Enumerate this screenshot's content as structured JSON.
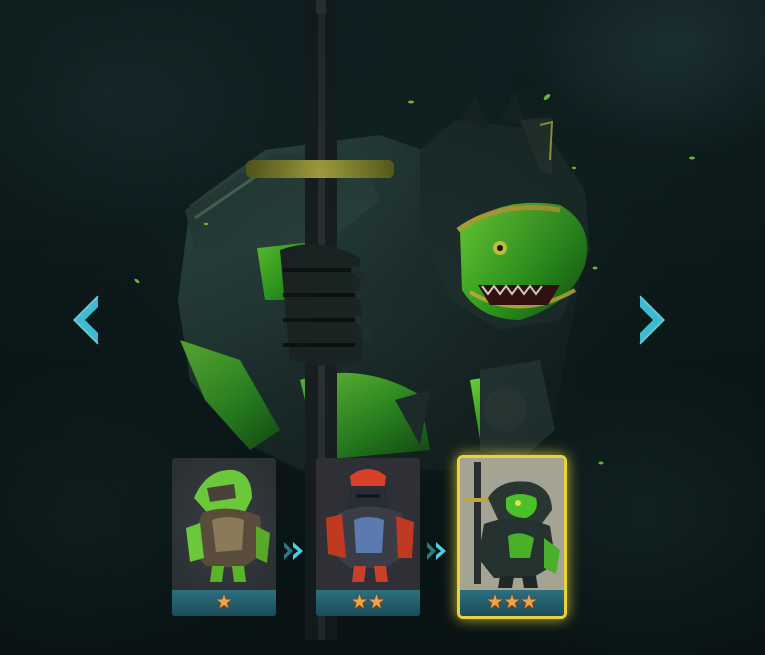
{
  "colors": {
    "accent_cyan": "#3cbcd0",
    "star_gold": "#f1a247",
    "selected_glow": "#e8d33a",
    "hero_green": "#3ec22a",
    "armor_dark": "#1d2a2a"
  },
  "navigation": {
    "prev_icon": "chevron-left-icon",
    "next_icon": "chevron-right-icon"
  },
  "evolution": {
    "arrow_icon": "double-chevron-right-icon",
    "selected_index": 2,
    "stages": [
      {
        "stars": "★",
        "star_count": 1,
        "palette": "green"
      },
      {
        "stars": "★★",
        "star_count": 2,
        "palette": "red-blue"
      },
      {
        "stars": "★★★",
        "star_count": 3,
        "palette": "dark-green-sword"
      }
    ]
  }
}
